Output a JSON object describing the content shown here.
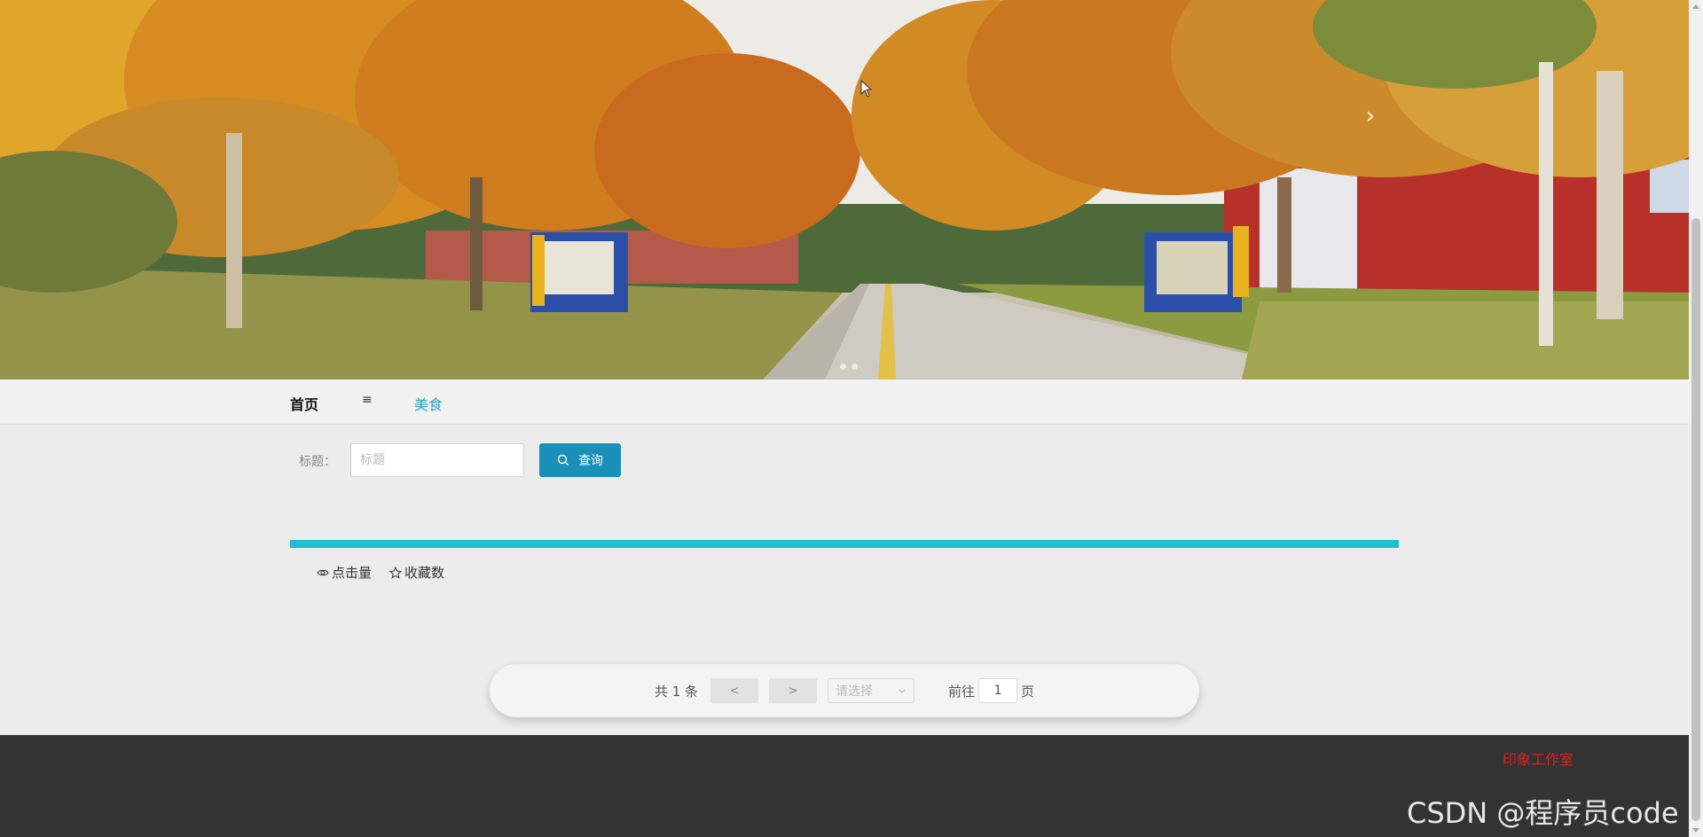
{
  "nav": {
    "home_label": "首页",
    "menu_icon": "≡",
    "food_label": "美食"
  },
  "search": {
    "label": "标题：",
    "placeholder": "标题",
    "button_label": "查询"
  },
  "item": {
    "views_label": "点击量",
    "favorites_label": "收藏数"
  },
  "pagination": {
    "total_text": "共 1 条",
    "prev_label": "<",
    "next_label": ">",
    "page_size_placeholder": "请选择",
    "goto_label": "前往",
    "current_page": "1",
    "page_suffix": "页"
  },
  "footer": {
    "brand": "印象工作室",
    "watermark": "CSDN @程序员code"
  },
  "colors": {
    "accent": "#1a8fb8",
    "card_bar": "#1fbdd0",
    "nav_active": "#2ea3b8",
    "footer_bg": "#333333",
    "brand_red": "#e02020"
  },
  "icons": [
    "chevron-right-icon",
    "menu-icon",
    "search-icon",
    "eye-icon",
    "star-icon",
    "chevron-down-icon"
  ]
}
